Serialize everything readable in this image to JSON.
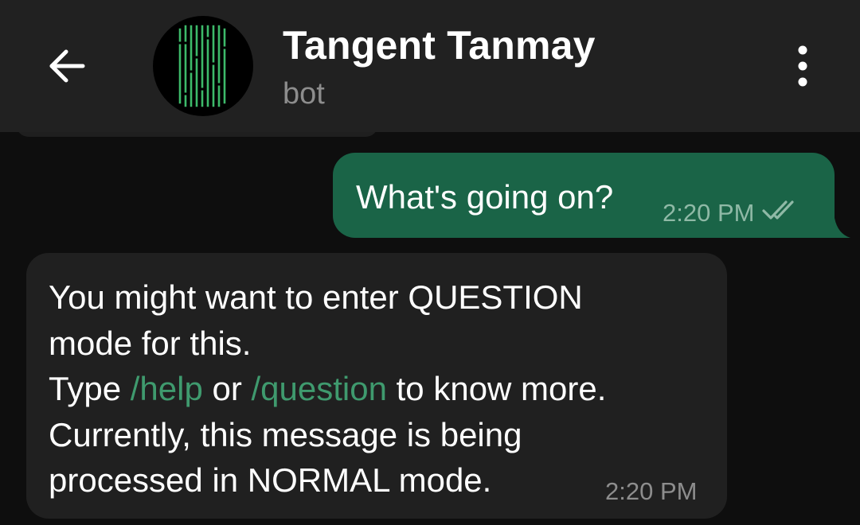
{
  "header": {
    "title": "Tangent Tanmay",
    "subtitle": "bot",
    "back_icon": "arrow-left-icon",
    "menu_icon": "more-vertical-icon"
  },
  "messages": [
    {
      "direction": "outgoing",
      "text": "What's going on?",
      "time": "2:20 PM",
      "status_icon": "double-check-icon"
    },
    {
      "direction": "incoming",
      "line1": "You might want to enter QUESTION",
      "line2": "mode for this.",
      "line3_pre": "Type ",
      "cmd_help": "/help",
      "line3_mid": " or ",
      "cmd_question": "/question",
      "line3_post": " to know more.",
      "line4": "Currently, this message is being",
      "line5": "processed in NORMAL mode.",
      "time": "2:20 PM"
    }
  ],
  "colors": {
    "background": "#0e0e0e",
    "header": "#212121",
    "outgoing_bubble": "#1a6447",
    "incoming_bubble": "#202020",
    "command_link": "#3f9a6e",
    "avatar_bars": "#3dba6a"
  }
}
